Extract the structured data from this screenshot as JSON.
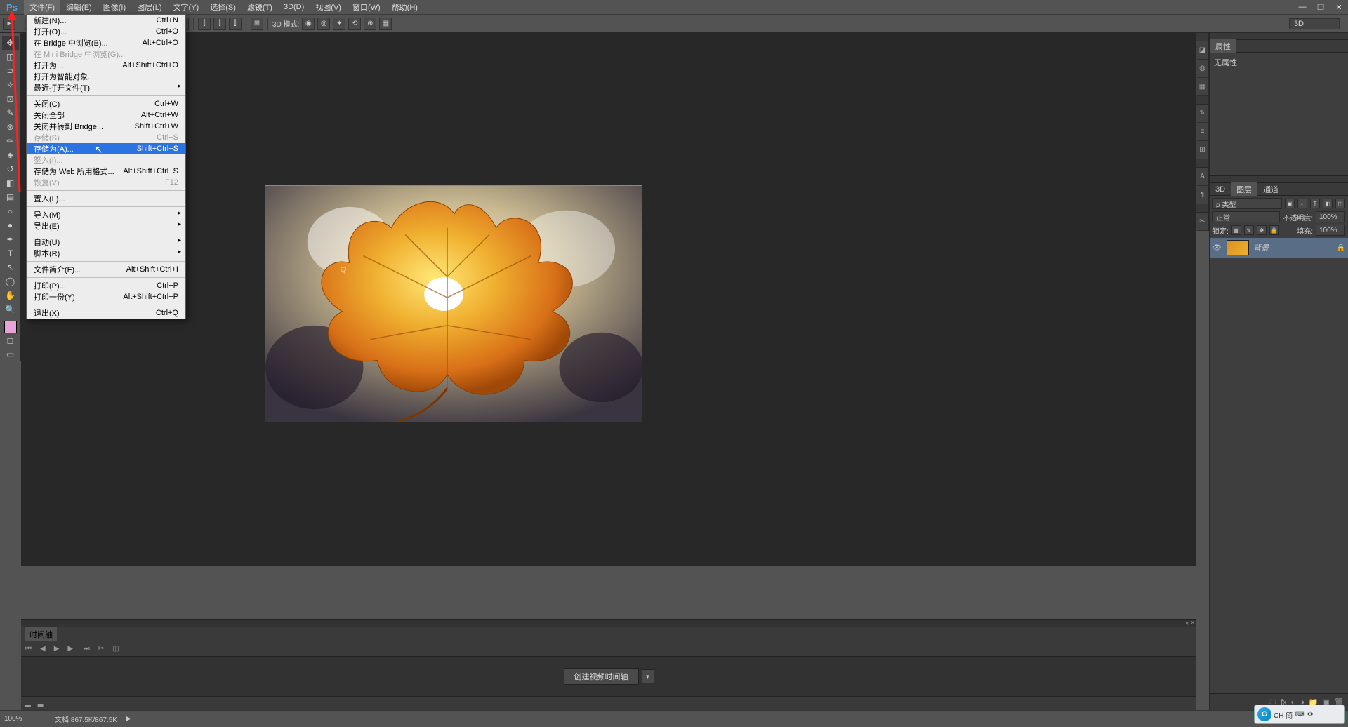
{
  "menubar": {
    "logo": "Ps",
    "items": [
      "文件(F)",
      "编辑(E)",
      "图像(I)",
      "图层(L)",
      "文字(Y)",
      "选择(S)",
      "滤镜(T)",
      "3D(D)",
      "视图(V)",
      "窗口(W)",
      "帮助(H)"
    ],
    "active_index": 0
  },
  "optbar": {
    "mode_label": "3D 模式:",
    "right_select": "3D"
  },
  "dropdown": {
    "groups": [
      [
        {
          "label": "新建(N)...",
          "shortcut": "Ctrl+N",
          "disabled": false
        },
        {
          "label": "打开(O)...",
          "shortcut": "Ctrl+O",
          "disabled": false
        },
        {
          "label": "在 Bridge 中浏览(B)...",
          "shortcut": "Alt+Ctrl+O",
          "disabled": false
        },
        {
          "label": "在 Mini Bridge 中浏览(G)...",
          "shortcut": "",
          "disabled": true
        },
        {
          "label": "打开为...",
          "shortcut": "Alt+Shift+Ctrl+O",
          "disabled": false
        },
        {
          "label": "打开为智能对象...",
          "shortcut": "",
          "disabled": false
        },
        {
          "label": "最近打开文件(T)",
          "shortcut": "",
          "disabled": false,
          "submenu": true
        }
      ],
      [
        {
          "label": "关闭(C)",
          "shortcut": "Ctrl+W",
          "disabled": false
        },
        {
          "label": "关闭全部",
          "shortcut": "Alt+Ctrl+W",
          "disabled": false
        },
        {
          "label": "关闭并转到 Bridge...",
          "shortcut": "Shift+Ctrl+W",
          "disabled": false
        },
        {
          "label": "存储(S)",
          "shortcut": "Ctrl+S",
          "disabled": true
        },
        {
          "label": "存储为(A)...",
          "shortcut": "Shift+Ctrl+S",
          "disabled": false,
          "highlight": true
        },
        {
          "label": "签入(I)...",
          "shortcut": "",
          "disabled": true
        },
        {
          "label": "存储为 Web 所用格式...",
          "shortcut": "Alt+Shift+Ctrl+S",
          "disabled": false
        },
        {
          "label": "恢复(V)",
          "shortcut": "F12",
          "disabled": true
        }
      ],
      [
        {
          "label": "置入(L)...",
          "shortcut": "",
          "disabled": false
        }
      ],
      [
        {
          "label": "导入(M)",
          "shortcut": "",
          "disabled": false,
          "submenu": true
        },
        {
          "label": "导出(E)",
          "shortcut": "",
          "disabled": false,
          "submenu": true
        }
      ],
      [
        {
          "label": "自动(U)",
          "shortcut": "",
          "disabled": false,
          "submenu": true
        },
        {
          "label": "脚本(R)",
          "shortcut": "",
          "disabled": false,
          "submenu": true
        }
      ],
      [
        {
          "label": "文件简介(F)...",
          "shortcut": "Alt+Shift+Ctrl+I",
          "disabled": false
        }
      ],
      [
        {
          "label": "打印(P)...",
          "shortcut": "Ctrl+P",
          "disabled": false
        },
        {
          "label": "打印一份(Y)",
          "shortcut": "Alt+Shift+Ctrl+P",
          "disabled": false
        }
      ],
      [
        {
          "label": "退出(X)",
          "shortcut": "Ctrl+Q",
          "disabled": false
        }
      ]
    ]
  },
  "properties": {
    "tab": "属性",
    "empty": "无属性"
  },
  "layers": {
    "tabs": [
      "3D",
      "图层",
      "通道"
    ],
    "active_tab": 1,
    "filter_label": "ρ 类型",
    "blend": "正常",
    "opacity_label": "不透明度:",
    "opacity_value": "100%",
    "lock_label": "锁定:",
    "fill_label": "填充:",
    "fill_value": "100%",
    "layer_name": "背景"
  },
  "timeline": {
    "tab": "时间轴",
    "button": "创建视频时间轴"
  },
  "status": {
    "zoom": "100%",
    "doc": "文档:867.5K/867.5K"
  },
  "ime": {
    "text": "CH 简"
  }
}
